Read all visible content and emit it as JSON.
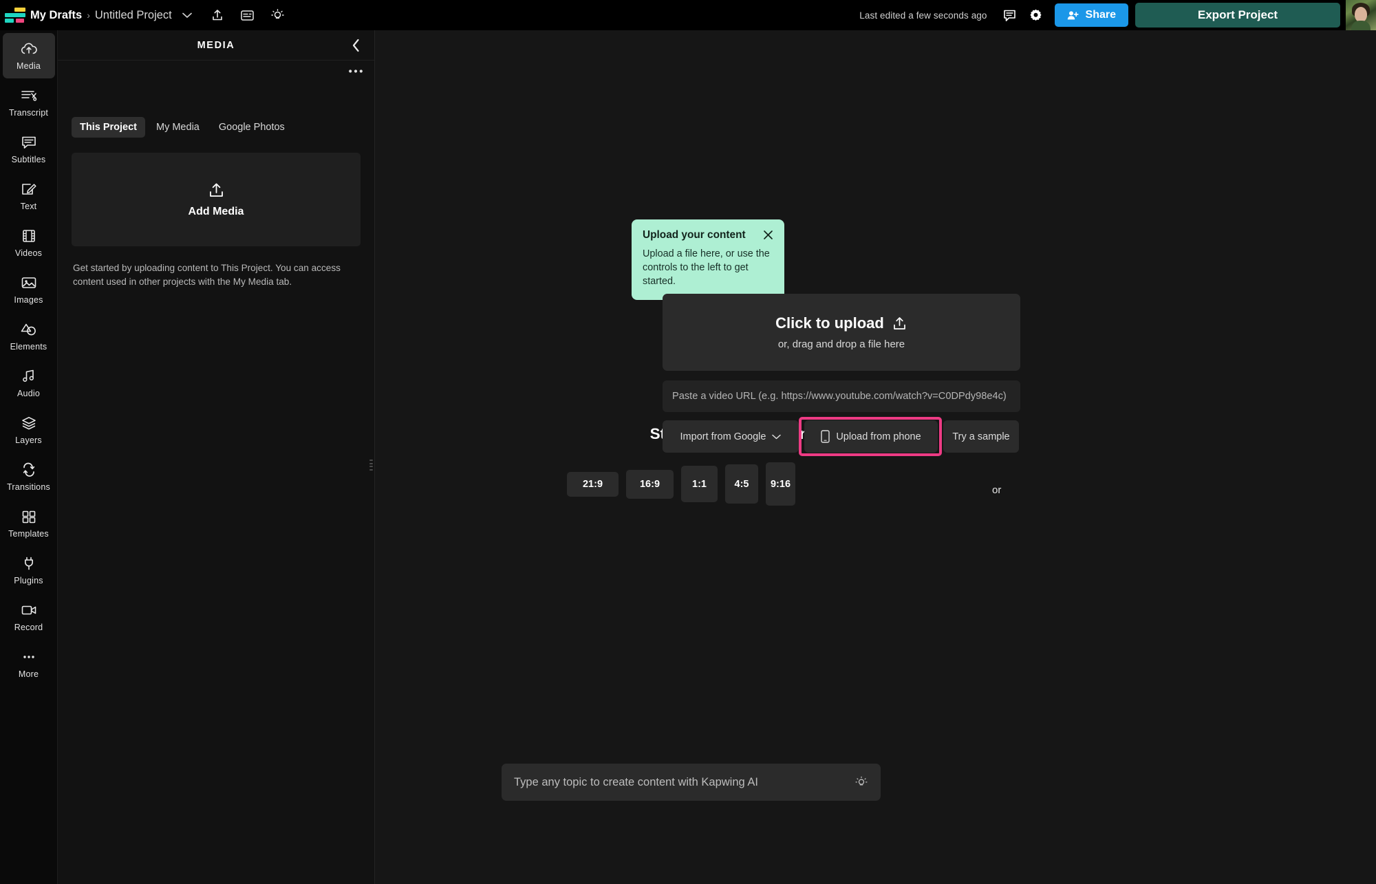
{
  "topbar": {
    "logo_name": "kapwing-logo",
    "breadcrumb_root": "My Drafts",
    "breadcrumb_separator": "›",
    "breadcrumb_current": "Untitled Project",
    "project_dropdown_icon": "chevron-down-icon",
    "share_upload_icon": "upload-icon",
    "captions_icon": "captions-icon",
    "ideas_icon": "lightbulb-icon",
    "last_edited": "Last edited a few seconds ago",
    "comments_icon": "comment-icon",
    "settings_icon": "gear-icon",
    "share_label": "Share",
    "export_label": "Export Project",
    "colors": {
      "share_bg": "#1B97E8",
      "export_bg": "#1F5C53",
      "logo_yellow": "#F5D13B",
      "logo_teal": "#1FD6C1",
      "logo_pink": "#F0457E"
    }
  },
  "rail": {
    "items": [
      {
        "label": "Media",
        "icon": "cloud-upload-icon",
        "active": true
      },
      {
        "label": "Transcript",
        "icon": "transcript-scissors-icon",
        "active": false
      },
      {
        "label": "Subtitles",
        "icon": "subtitles-bubble-icon",
        "active": false
      },
      {
        "label": "Text",
        "icon": "text-edit-icon",
        "active": false
      },
      {
        "label": "Videos",
        "icon": "film-strip-icon",
        "active": false
      },
      {
        "label": "Images",
        "icon": "image-icon",
        "active": false
      },
      {
        "label": "Elements",
        "icon": "shapes-icon",
        "active": false
      },
      {
        "label": "Audio",
        "icon": "music-note-icon",
        "active": false
      },
      {
        "label": "Layers",
        "icon": "layers-icon",
        "active": false
      },
      {
        "label": "Transitions",
        "icon": "transitions-arrows-icon",
        "active": false
      },
      {
        "label": "Templates",
        "icon": "grid-squares-icon",
        "active": false
      },
      {
        "label": "Plugins",
        "icon": "plug-icon",
        "active": false
      },
      {
        "label": "Record",
        "icon": "video-camera-icon",
        "active": false
      },
      {
        "label": "More",
        "icon": "ellipsis-icon",
        "active": false
      }
    ]
  },
  "panel": {
    "title": "MEDIA",
    "collapse_icon": "chevron-left-icon",
    "kebab_icon": "more-options-icon",
    "tabs": [
      {
        "label": "This Project",
        "active": true
      },
      {
        "label": "My Media",
        "active": false
      },
      {
        "label": "Google Photos",
        "active": false
      }
    ],
    "add_media_label": "Add Media",
    "add_media_icon": "upload-icon",
    "help_text": "Get started by uploading content to This Project. You can access content used in other projects with the My Media tab."
  },
  "stage": {
    "blank_canvas_title": "Start with a blank canvas",
    "ratios": [
      "21:9",
      "16:9",
      "1:1",
      "4:5",
      "9:16"
    ],
    "or_label": "or",
    "upload": {
      "title": "Click to upload",
      "title_icon": "upload-icon",
      "subtitle": "or, drag and drop a file here",
      "url_placeholder": "Paste a video URL (e.g. https://www.youtube.com/watch?v=C0DPdy98e4c)",
      "url_value": "",
      "sources": [
        {
          "label": "Import from Google",
          "icon": "chevron-down-icon",
          "highlighted": false
        },
        {
          "label": "Upload from phone",
          "icon": "phone-icon",
          "highlighted": true
        },
        {
          "label": "Try a sample",
          "icon": "",
          "highlighted": false
        }
      ],
      "highlight_color": "#ED3B84"
    },
    "tooltip": {
      "title": "Upload your content",
      "body": "Upload a file here, or use the controls to the left to get started.",
      "close_icon": "close-icon",
      "bg_color": "#AEEFD3"
    },
    "ai_bar": {
      "placeholder": "Type any topic to create content with Kapwing AI",
      "value": "",
      "icon": "lightbulb-icon"
    }
  }
}
